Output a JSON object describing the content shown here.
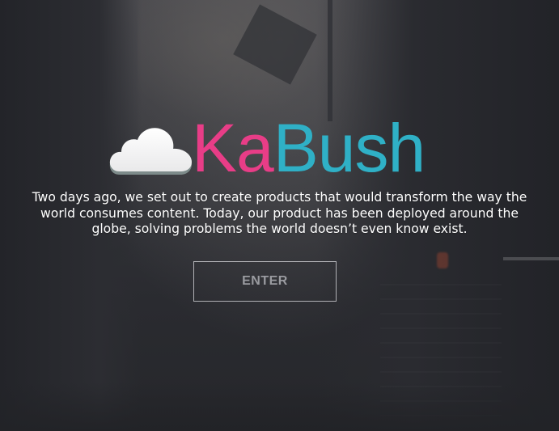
{
  "logo": {
    "icon": "cloud-icon",
    "wordmark_part1": "Ka",
    "wordmark_part2": "Bush",
    "colors": {
      "ka": "#e83d87",
      "bush": "#2fb0c6",
      "cloud": "#f4f4f4"
    }
  },
  "hero": {
    "tagline": "Two days ago, we set out to create products that would transform the way the world consumes content. Today, our product has been deployed around the globe, solving problems the world doesn’t even know exist.",
    "enter_label": "ENTER"
  }
}
